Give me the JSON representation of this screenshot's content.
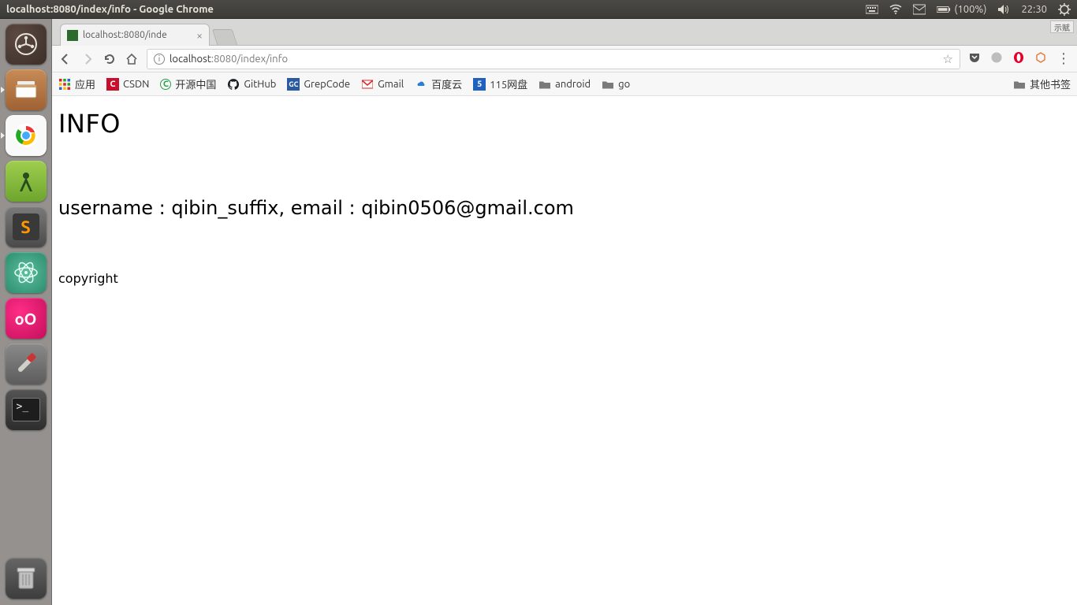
{
  "menubar": {
    "window_title": "localhost:8080/index/info - Google Chrome",
    "battery_text": "(100%)",
    "clock": "22:30"
  },
  "ime_box": "示赋",
  "launcher": {
    "items": [
      {
        "name": "dash",
        "label": "Dash"
      },
      {
        "name": "files",
        "label": "Files"
      },
      {
        "name": "chrome",
        "label": "Google Chrome"
      },
      {
        "name": "android-studio",
        "label": "Android Studio"
      },
      {
        "name": "sublime",
        "label": "Sublime Text"
      },
      {
        "name": "atom",
        "label": "Atom"
      },
      {
        "name": "oo",
        "label": "oO"
      },
      {
        "name": "settings",
        "label": "System Settings"
      },
      {
        "name": "terminal",
        "label": "Terminal"
      }
    ]
  },
  "chrome": {
    "tab": {
      "title": "localhost:8080/inde"
    },
    "address": {
      "host": "localhost",
      "port_path": ":8080/index/info"
    },
    "bookmarks_bar": {
      "apps": "应用",
      "items": [
        {
          "label": "CSDN",
          "color": "#d22",
          "glyph": "C"
        },
        {
          "label": "开源中国",
          "color": "#2a9d4a",
          "glyph": "C"
        },
        {
          "label": "GitHub",
          "color": "#000",
          "glyph": "gh"
        },
        {
          "label": "GrepCode",
          "color": "#2a5aa0",
          "glyph": "GC"
        },
        {
          "label": "Gmail",
          "color": "#d22",
          "glyph": "M"
        },
        {
          "label": "百度云",
          "color": "#2a7ed6",
          "glyph": "bd"
        },
        {
          "label": "115网盘",
          "color": "#2060c0",
          "glyph": "5"
        },
        {
          "label": "android",
          "color": "folder"
        },
        {
          "label": "go",
          "color": "folder"
        }
      ],
      "other": "其他书签"
    }
  },
  "page": {
    "heading": "INFO",
    "info_line": "username : qibin_suffix, email : qibin0506@gmail.com",
    "copyright": "copyright"
  }
}
